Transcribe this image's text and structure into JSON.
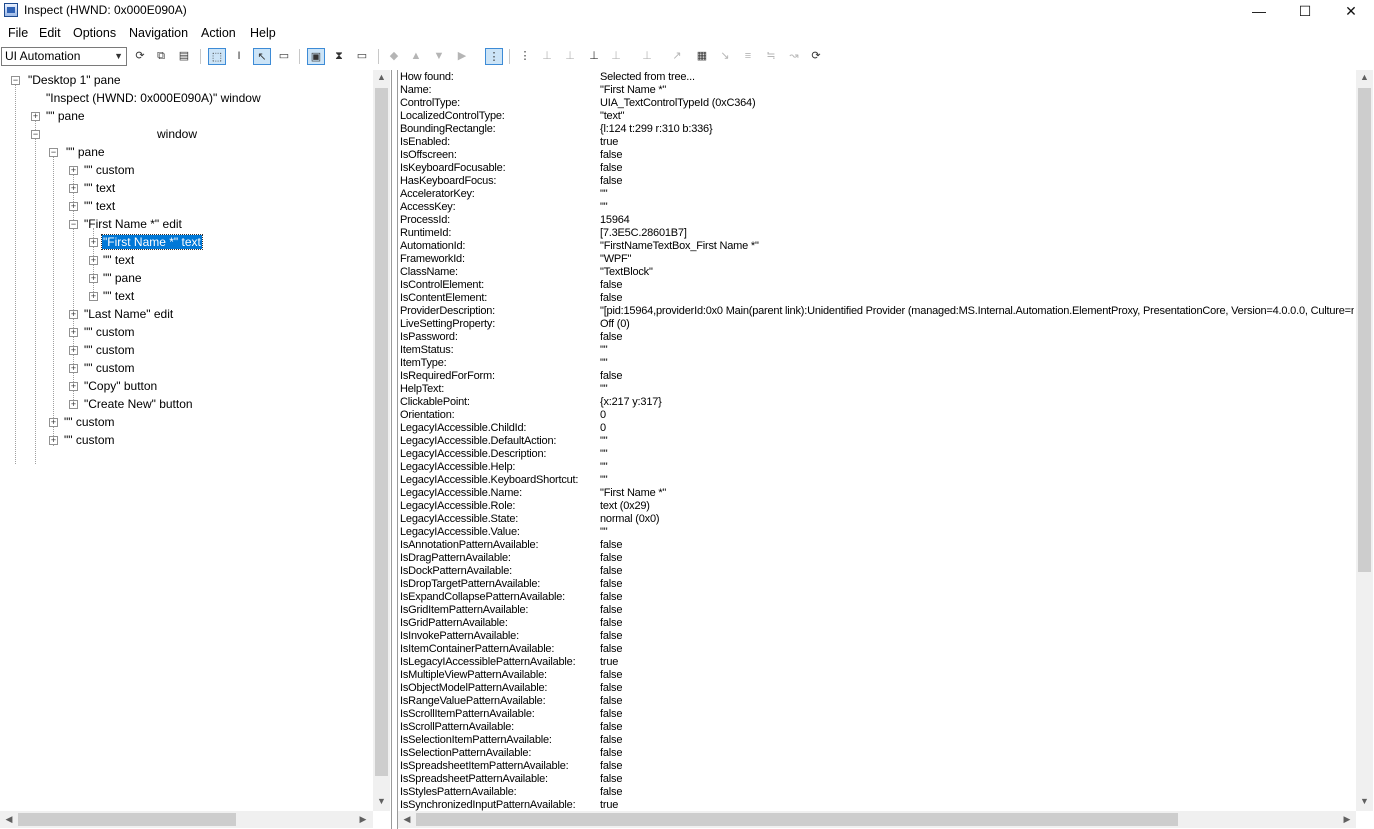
{
  "window": {
    "title": "Inspect  (HWND: 0x000E090A)",
    "minimize": "—",
    "maximize": "☐",
    "close": "✕"
  },
  "menu": [
    "File",
    "Edit",
    "Options",
    "Navigation",
    "Action",
    "Help"
  ],
  "toolbar": {
    "mode_value": "UI Automation",
    "icons": [
      "refresh-icon",
      "copy-icon",
      "properties-icon",
      "watch-focus-icon",
      "watch-caret-icon",
      "watch-cursor-icon",
      "watch-tooltip-icon",
      "highlight-icon",
      "show-rectangle-icon",
      "caret-tracking-icon",
      "nav-back-icon",
      "nav-up-icon",
      "nav-down-icon",
      "nav-forward-icon",
      "tree-mode-icon",
      "nav-parent-icon",
      "nav-first-child-icon",
      "nav-prev-sibling-icon",
      "nav-next-sibling-icon",
      "nav-last-child-icon",
      "action-1-icon",
      "action-2-icon",
      "action-3-icon",
      "action-4-icon",
      "action-5-icon",
      "action-6-icon",
      "action-7-icon"
    ]
  },
  "tree": [
    {
      "label": "\"Desktop 1\" pane"
    },
    {
      "label": "\"Inspect  (HWND: 0x000E090A)\" window"
    },
    {
      "label": "\"\" pane"
    },
    {
      "label": "window"
    },
    {
      "label": "\"\" pane"
    },
    {
      "label": "\"\" custom"
    },
    {
      "label": "\"\" text"
    },
    {
      "label": "\"\" text"
    },
    {
      "label": "\"First Name *\" edit"
    },
    {
      "label": "\"First Name *\" text"
    },
    {
      "label": "\"\" text"
    },
    {
      "label": "\"\" pane"
    },
    {
      "label": "\"\" text"
    },
    {
      "label": "\"Last Name\" edit"
    },
    {
      "label": "\"\" custom"
    },
    {
      "label": "\"\" custom"
    },
    {
      "label": "\"\" custom"
    },
    {
      "label": "\"Copy\" button"
    },
    {
      "label": "\"Create New\" button"
    },
    {
      "label": "\"\" custom"
    },
    {
      "label": "\"\" custom"
    }
  ],
  "properties": [
    [
      "How found:",
      "Selected from tree..."
    ],
    [
      "Name:",
      "\"First Name *\""
    ],
    [
      "ControlType:",
      "UIA_TextControlTypeId (0xC364)"
    ],
    [
      "LocalizedControlType:",
      "\"text\""
    ],
    [
      "BoundingRectangle:",
      "{l:124 t:299 r:310 b:336}"
    ],
    [
      "IsEnabled:",
      "true"
    ],
    [
      "IsOffscreen:",
      "false"
    ],
    [
      "IsKeyboardFocusable:",
      "false"
    ],
    [
      "HasKeyboardFocus:",
      "false"
    ],
    [
      "AcceleratorKey:",
      "\"\""
    ],
    [
      "AccessKey:",
      "\"\""
    ],
    [
      "ProcessId:",
      "15964"
    ],
    [
      "RuntimeId:",
      "[7.3E5C.28601B7]"
    ],
    [
      "AutomationId:",
      "\"FirstNameTextBox_First Name *\""
    ],
    [
      "FrameworkId:",
      "\"WPF\""
    ],
    [
      "ClassName:",
      "\"TextBlock\""
    ],
    [
      "IsControlElement:",
      "false"
    ],
    [
      "IsContentElement:",
      "false"
    ],
    [
      "ProviderDescription:",
      "\"[pid:15964,providerId:0x0 Main(parent link):Unidentified Provider (managed:MS.Internal.Automation.ElementProxy, PresentationCore, Version=4.0.0.0, Culture=n"
    ],
    [
      "LiveSettingProperty:",
      "Off (0)"
    ],
    [
      "IsPassword:",
      "false"
    ],
    [
      "ItemStatus:",
      "\"\""
    ],
    [
      "ItemType:",
      "\"\""
    ],
    [
      "IsRequiredForForm:",
      "false"
    ],
    [
      "HelpText:",
      "\"\""
    ],
    [
      "ClickablePoint:",
      "{x:217 y:317}"
    ],
    [
      "Orientation:",
      "0"
    ],
    [
      "LegacyIAccessible.ChildId:",
      "0"
    ],
    [
      "LegacyIAccessible.DefaultAction:",
      "\"\""
    ],
    [
      "LegacyIAccessible.Description:",
      "\"\""
    ],
    [
      "LegacyIAccessible.Help:",
      "\"\""
    ],
    [
      "LegacyIAccessible.KeyboardShortcut:",
      "\"\""
    ],
    [
      "LegacyIAccessible.Name:",
      "\"First Name *\""
    ],
    [
      "LegacyIAccessible.Role:",
      "text (0x29)"
    ],
    [
      "LegacyIAccessible.State:",
      "normal (0x0)"
    ],
    [
      "LegacyIAccessible.Value:",
      "\"\""
    ],
    [
      "IsAnnotationPatternAvailable:",
      "false"
    ],
    [
      "IsDragPatternAvailable:",
      "false"
    ],
    [
      "IsDockPatternAvailable:",
      "false"
    ],
    [
      "IsDropTargetPatternAvailable:",
      "false"
    ],
    [
      "IsExpandCollapsePatternAvailable:",
      "false"
    ],
    [
      "IsGridItemPatternAvailable:",
      "false"
    ],
    [
      "IsGridPatternAvailable:",
      "false"
    ],
    [
      "IsInvokePatternAvailable:",
      "false"
    ],
    [
      "IsItemContainerPatternAvailable:",
      "false"
    ],
    [
      "IsLegacyIAccessiblePatternAvailable:",
      "true"
    ],
    [
      "IsMultipleViewPatternAvailable:",
      "false"
    ],
    [
      "IsObjectModelPatternAvailable:",
      "false"
    ],
    [
      "IsRangeValuePatternAvailable:",
      "false"
    ],
    [
      "IsScrollItemPatternAvailable:",
      "false"
    ],
    [
      "IsScrollPatternAvailable:",
      "false"
    ],
    [
      "IsSelectionItemPatternAvailable:",
      "false"
    ],
    [
      "IsSelectionPatternAvailable:",
      "false"
    ],
    [
      "IsSpreadsheetItemPatternAvailable:",
      "false"
    ],
    [
      "IsSpreadsheetPatternAvailable:",
      "false"
    ],
    [
      "IsStylesPatternAvailable:",
      "false"
    ],
    [
      "IsSynchronizedInputPatternAvailable:",
      "true"
    ]
  ]
}
